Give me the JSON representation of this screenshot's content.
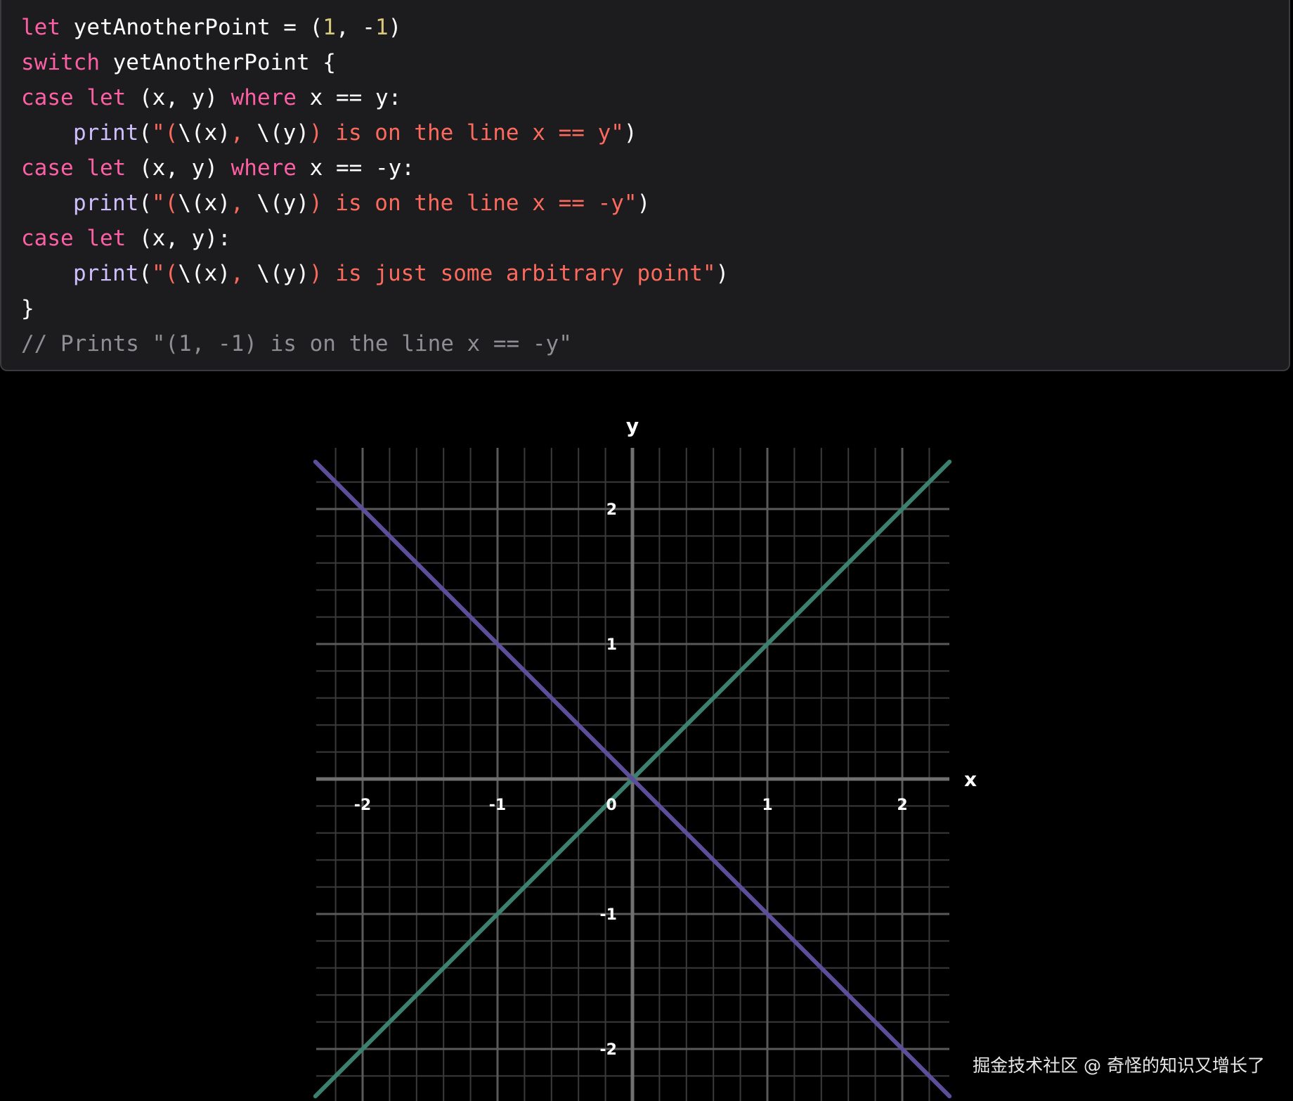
{
  "code": {
    "lines": [
      [
        {
          "t": "kw",
          "v": "let"
        },
        {
          "t": "plain",
          "v": " yetAnotherPoint = ("
        },
        {
          "t": "num",
          "v": "1"
        },
        {
          "t": "plain",
          "v": ", -"
        },
        {
          "t": "num",
          "v": "1"
        },
        {
          "t": "plain",
          "v": ")"
        }
      ],
      [
        {
          "t": "kw",
          "v": "switch"
        },
        {
          "t": "plain",
          "v": " yetAnotherPoint {"
        }
      ],
      [
        {
          "t": "kw",
          "v": "case"
        },
        {
          "t": "plain",
          "v": " "
        },
        {
          "t": "kw",
          "v": "let"
        },
        {
          "t": "plain",
          "v": " (x, y) "
        },
        {
          "t": "kw",
          "v": "where"
        },
        {
          "t": "plain",
          "v": " x == y:"
        }
      ],
      [
        {
          "t": "indent",
          "v": ""
        },
        {
          "t": "fn",
          "v": "print"
        },
        {
          "t": "plain",
          "v": "("
        },
        {
          "t": "str",
          "v": "\"("
        },
        {
          "t": "plain",
          "v": "\\(x)"
        },
        {
          "t": "str",
          "v": ", "
        },
        {
          "t": "plain",
          "v": "\\(y)"
        },
        {
          "t": "str",
          "v": ") is on the line x == y\""
        },
        {
          "t": "plain",
          "v": ")"
        }
      ],
      [
        {
          "t": "kw",
          "v": "case"
        },
        {
          "t": "plain",
          "v": " "
        },
        {
          "t": "kw",
          "v": "let"
        },
        {
          "t": "plain",
          "v": " (x, y) "
        },
        {
          "t": "kw",
          "v": "where"
        },
        {
          "t": "plain",
          "v": " x == -y:"
        }
      ],
      [
        {
          "t": "indent",
          "v": ""
        },
        {
          "t": "fn",
          "v": "print"
        },
        {
          "t": "plain",
          "v": "("
        },
        {
          "t": "str",
          "v": "\"("
        },
        {
          "t": "plain",
          "v": "\\(x)"
        },
        {
          "t": "str",
          "v": ", "
        },
        {
          "t": "plain",
          "v": "\\(y)"
        },
        {
          "t": "str",
          "v": ") is on the line x == -y\""
        },
        {
          "t": "plain",
          "v": ")"
        }
      ],
      [
        {
          "t": "kw",
          "v": "case"
        },
        {
          "t": "plain",
          "v": " "
        },
        {
          "t": "kw",
          "v": "let"
        },
        {
          "t": "plain",
          "v": " (x, y):"
        }
      ],
      [
        {
          "t": "indent",
          "v": ""
        },
        {
          "t": "fn",
          "v": "print"
        },
        {
          "t": "plain",
          "v": "("
        },
        {
          "t": "str",
          "v": "\"("
        },
        {
          "t": "plain",
          "v": "\\(x)"
        },
        {
          "t": "str",
          "v": ", "
        },
        {
          "t": "plain",
          "v": "\\(y)"
        },
        {
          "t": "str",
          "v": ") is just some arbitrary point\""
        },
        {
          "t": "plain",
          "v": ")"
        }
      ],
      [
        {
          "t": "plain",
          "v": "}"
        }
      ],
      [
        {
          "t": "cmt",
          "v": "// Prints \"(1, -1) is on the line x == -y\""
        }
      ]
    ]
  },
  "chart_data": {
    "type": "line",
    "xlabel": "x",
    "ylabel": "y",
    "xlim": [
      -2.35,
      2.35
    ],
    "ylim": [
      -2.35,
      2.35
    ],
    "grid": true,
    "major_ticks": [
      -2,
      -1,
      0,
      1,
      2
    ],
    "minor_step": 0.2,
    "tick_labels": {
      "x": [
        "-2",
        "-1",
        "0",
        "1",
        "2"
      ],
      "y": [
        "-2",
        "-1",
        "1",
        "2"
      ]
    },
    "series": [
      {
        "color": "#3b8070",
        "x": [
          -2.35,
          2.35
        ],
        "y": [
          -2.35,
          2.35
        ]
      },
      {
        "color": "#5d4e9b",
        "x": [
          -2.35,
          2.35
        ],
        "y": [
          2.35,
          -2.35
        ]
      }
    ]
  },
  "colors": {
    "keyword": "#fc5fa3",
    "number": "#d9c97c",
    "string": "#fc6a5d",
    "function": "#d0bfff",
    "comment": "#8e8e93",
    "grid_major": "#5a5a5a",
    "grid_minor": "#3a3a3a",
    "axis": "#707070"
  },
  "watermark": "掘金技术社区 @ 奇怪的知识又增长了"
}
